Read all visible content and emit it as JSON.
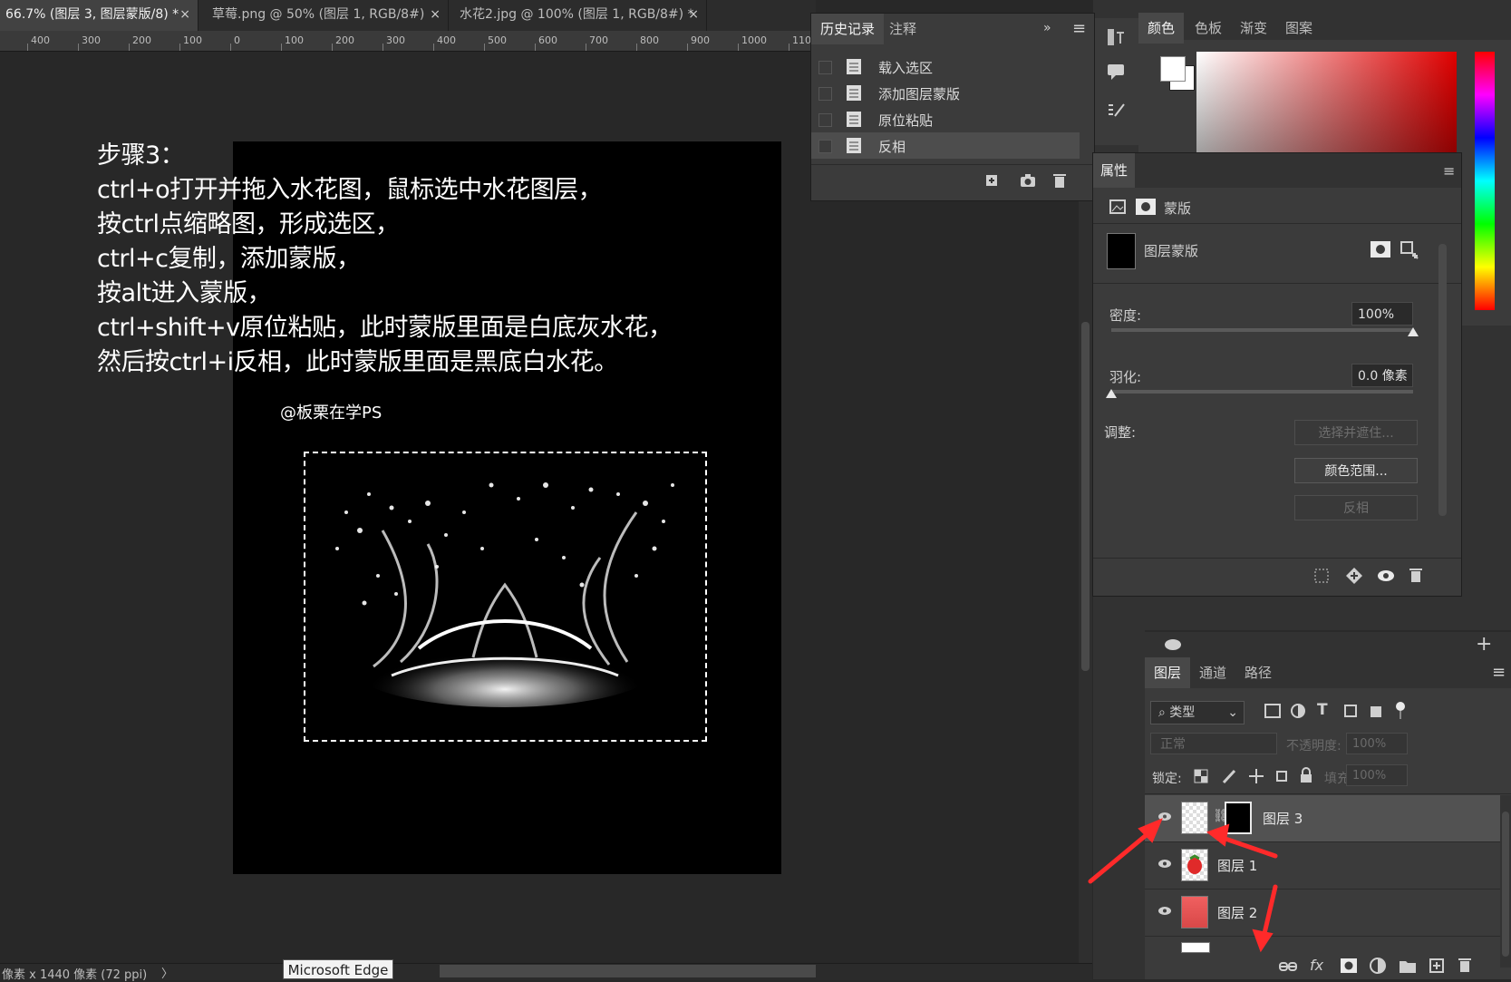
{
  "tabs": [
    {
      "label": "66.7% (图层 3, 图层蒙版/8) *",
      "active": true
    },
    {
      "label": "草莓.png @ 50% (图层 1, RGB/8#)",
      "active": false
    },
    {
      "label": "水花2.jpg @ 100% (图层 1, RGB/8#) *",
      "active": false
    }
  ],
  "tab_close": "×",
  "ruler": [
    "400",
    "300",
    "200",
    "100",
    "0",
    "100",
    "200",
    "300",
    "400",
    "500",
    "600",
    "700",
    "800",
    "900",
    "1000",
    "110"
  ],
  "instructions": [
    "步骤3：",
    "ctrl+o打开并拖入水花图，鼠标选中水花图层，",
    "按ctrl点缩略图，形成选区，",
    "ctrl+c复制，添加蒙版，",
    "按alt进入蒙版，",
    "ctrl+shift+v原位粘贴，此时蒙版里面是白底灰水花，",
    "然后按ctrl+i反相，此时蒙版里面是黑底白水花。"
  ],
  "watermark": "@板栗在学PS",
  "status": {
    "text": "像素 x 1440 像素 (72 ppi)",
    "arrow": "〉"
  },
  "tooltip": "Microsoft Edge",
  "history": {
    "tabs": [
      "历史记录",
      "注释"
    ],
    "items": [
      "载入选区",
      "添加图层蒙版",
      "原位粘贴",
      "反相"
    ],
    "selected_index": 3
  },
  "color_panel": {
    "tabs": [
      "颜色",
      "色板",
      "渐变",
      "图案"
    ],
    "foreground": "#ffffff",
    "background": "#ffffff"
  },
  "properties": {
    "title": "属性",
    "type_label": "蒙版",
    "mask_label": "图层蒙版",
    "density_label": "密度:",
    "density_value": "100%",
    "feather_label": "羽化:",
    "feather_value": "0.0 像素",
    "adjust_label": "调整:",
    "btn_select_mask": "选择并遮住...",
    "btn_color_range": "颜色范围...",
    "btn_invert": "反相"
  },
  "layers_panel": {
    "tabs": [
      "图层",
      "通道",
      "路径"
    ],
    "filter_label": "类型",
    "blend_mode": "正常",
    "opacity_label": "不透明度:",
    "opacity_value": "100%",
    "lock_label": "锁定:",
    "fill_label": "填充:",
    "fill_value": "100%",
    "layers": [
      {
        "name": "图层 3",
        "selected": true
      },
      {
        "name": "图层 1",
        "selected": false
      },
      {
        "name": "图层 2",
        "selected": false
      }
    ],
    "footer_fx": "fx"
  },
  "accent_arrow_color": "#ff2a2a"
}
